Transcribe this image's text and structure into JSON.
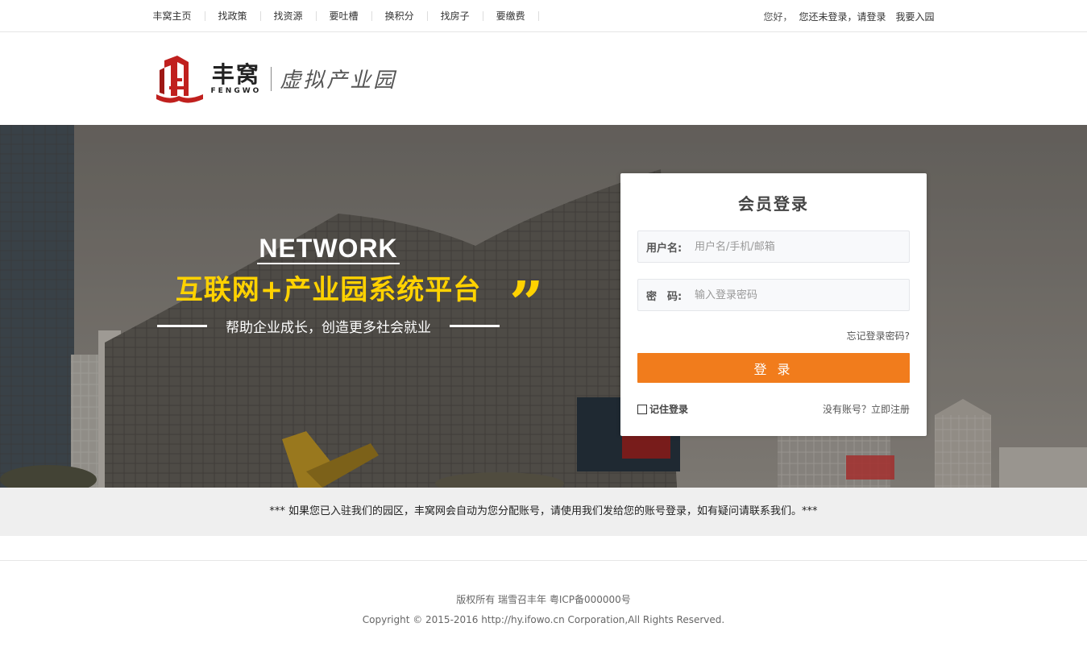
{
  "topnav": {
    "items": [
      "丰窝主页",
      "找政策",
      "找资源",
      "要吐槽",
      "换积分",
      "找房子",
      "要缴费"
    ],
    "greeting": "您好，",
    "login_link": "您还未登录，请登录",
    "join_link": "我要入园"
  },
  "header": {
    "logo_cn": "丰窝",
    "logo_en": "FENGWO",
    "logo_sub": "虚拟产业园"
  },
  "banner": {
    "slogan_en": "NETWORK",
    "slogan_cn": "互联网+产业园系统平台",
    "slogan_sub": "帮助企业成长，创造更多社会就业",
    "quote": "”"
  },
  "login": {
    "title": "会员登录",
    "username_label": "用户名:",
    "username_placeholder": "用户名/手机/邮箱",
    "password_label": "密　码:",
    "password_placeholder": "输入登录密码",
    "forgot": "忘记登录密码?",
    "submit": "登 录",
    "remember": "记住登录",
    "register": "没有账号？立即注册"
  },
  "notice": "*** 如果您已入驻我们的园区，丰窝网会自动为您分配账号，请使用我们发给您的账号登录，如有疑问请联系我们。***",
  "footer": {
    "line1": "版权所有 瑞雪召丰年 粤ICP备000000号",
    "line2": "Copyright © 2015-2016 http://hy.ifowo.cn Corporation,All Rights Reserved."
  },
  "colors": {
    "accent": "#f17c1c",
    "slogan_yellow": "#ffd200",
    "logo_red": "#c0201e"
  }
}
